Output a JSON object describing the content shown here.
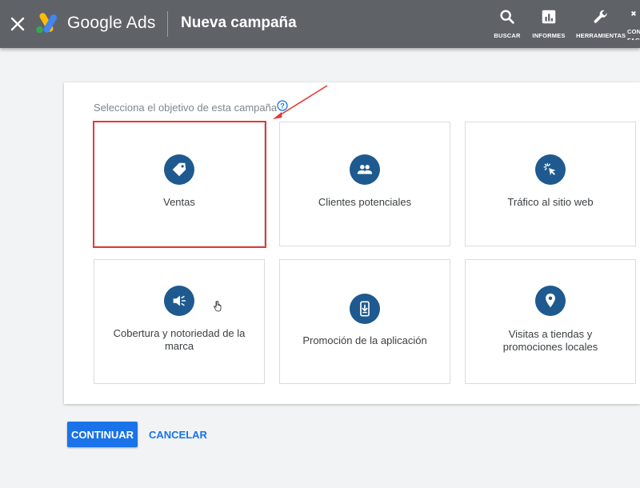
{
  "header": {
    "brand": "Google Ads",
    "page_title": "Nueva campaña",
    "tools": [
      {
        "label": "BUSCAR",
        "icon": "search-icon"
      },
      {
        "label": "INFORMES",
        "icon": "reports-icon"
      },
      {
        "label": "HERRAMIENTAS",
        "icon": "wrench-icon"
      },
      {
        "label": "CON FACT",
        "icon": "billing-icon"
      }
    ]
  },
  "objective": {
    "prompt": "Selecciona el objetivo de esta campaña",
    "tiles": [
      {
        "label": "Ventas",
        "icon": "tag-icon",
        "selected": true
      },
      {
        "label": "Clientes potenciales",
        "icon": "people-icon",
        "selected": false
      },
      {
        "label": "Tráfico al sitio web",
        "icon": "click-cursor-icon",
        "selected": false
      },
      {
        "label": "Cobertura y notoriedad de la marca",
        "icon": "megaphone-icon",
        "selected": false
      },
      {
        "label": "Promoción de la aplicación",
        "icon": "phone-download-icon",
        "selected": false
      },
      {
        "label": "Visitas a tiendas y promociones locales",
        "icon": "location-pin-icon",
        "selected": false
      }
    ]
  },
  "actions": {
    "continue_label": "CONTINUAR",
    "cancel_label": "CANCELAR"
  },
  "colors": {
    "header_bg": "#5f6368",
    "accent": "#1a73e8",
    "icon_circle": "#1e5a8f",
    "highlight": "#e53935"
  }
}
